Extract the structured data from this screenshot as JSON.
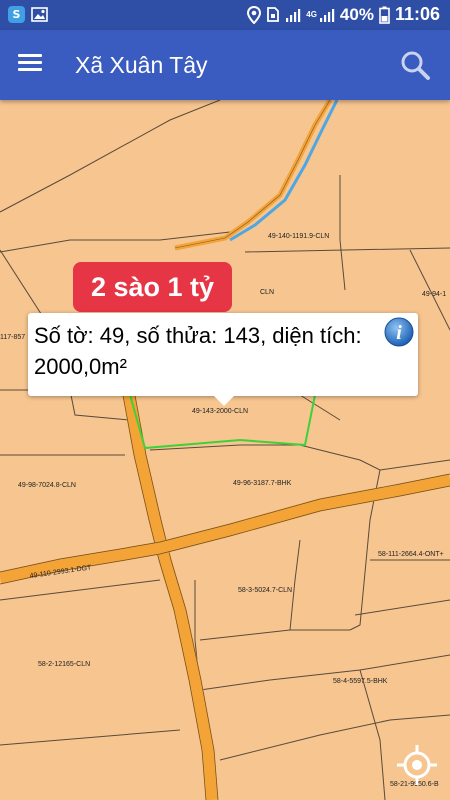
{
  "status_bar": {
    "network_label": "4G",
    "battery": "40%",
    "time": "11:06"
  },
  "app_bar": {
    "title": "Xã Xuân Tây"
  },
  "banner": {
    "text": "2 sào 1 tỷ"
  },
  "popup": {
    "text": "Số tờ: 49, số thửa: 143, diện tích: 2000,0m²"
  },
  "parcels": [
    "49-140-1191.9-CLN",
    "CLN",
    "49-94-1",
    "117-857",
    "49-143-2000-CLN",
    "49-96-3187.7-BHK",
    "49-98-7024.8-CLN",
    "58-111-2664.4-ONT+",
    "49-110-2993.1-DGT",
    "58-3-5024.7-CLN",
    "58-2-12165-CLN",
    "58-4-5597.5-BHK",
    "58-21-9950.6-B"
  ],
  "colors": {
    "status_bar": "#2f4fa6",
    "app_bar": "#3a5bbf",
    "map_parcel": "#f6c590",
    "road": "#f4a336",
    "selected_parcel_outline": "#3dd23a",
    "river": "#4ea7e3",
    "banner": "#e63545"
  },
  "icons": [
    "menu-icon",
    "search-icon",
    "info-icon",
    "locate-icon",
    "location-pin-icon",
    "wifi-icon",
    "signal-icon",
    "battery-icon"
  ]
}
